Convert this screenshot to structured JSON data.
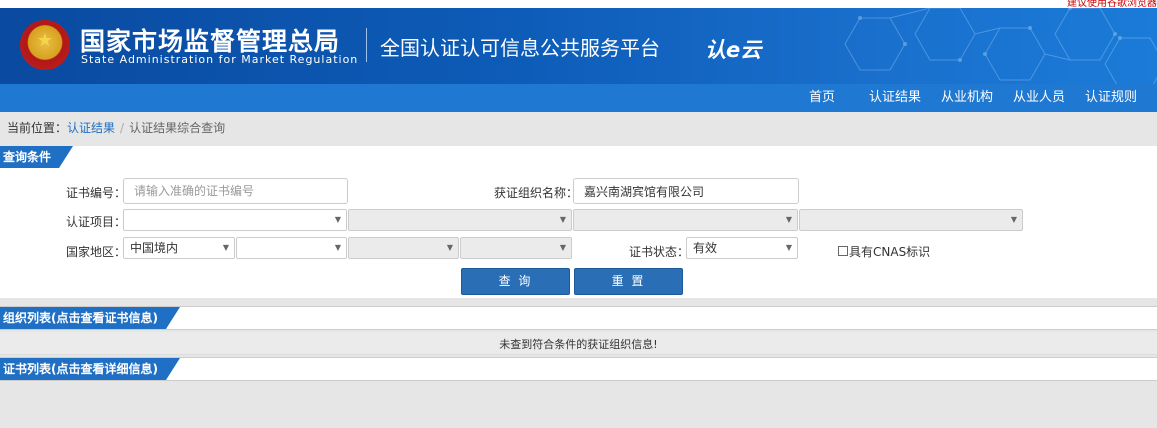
{
  "top_notice": "建议使用谷歌浏览器",
  "header": {
    "agency_cn": "国家市场监督管理总局",
    "agency_en": "State Administration  for  Market Regulation",
    "platform_title": "全国认证认可信息公共服务平台",
    "logo_text": "认e云"
  },
  "nav": {
    "items": [
      {
        "label": "首页"
      },
      {
        "label": "认证结果"
      },
      {
        "label": "从业机构"
      },
      {
        "label": "从业人员"
      },
      {
        "label": "认证规则"
      }
    ]
  },
  "breadcrumb": {
    "prefix": "当前位置：",
    "link": "认证结果",
    "separator": "/",
    "current": "认证结果综合查询"
  },
  "query_section": {
    "title": "查询条件",
    "cert_no_label": "证书编号：",
    "cert_no_placeholder": "请输入准确的证书编号",
    "org_name_label": "获证组织名称：",
    "org_name_value": "嘉兴南湖宾馆有限公司",
    "project_label": "认证项目：",
    "region_label": "国家地区：",
    "region_value": "中国境内",
    "status_label": "证书状态：",
    "status_value": "有效",
    "cnas_label": "具有CNAS标识",
    "query_button": "查 询",
    "reset_button": "重 置"
  },
  "org_list": {
    "title": "组织列表(点击查看证书信息)",
    "empty_message": "未查到符合条件的获证组织信息!"
  },
  "cert_list": {
    "title": "证书列表(点击查看详细信息)"
  }
}
